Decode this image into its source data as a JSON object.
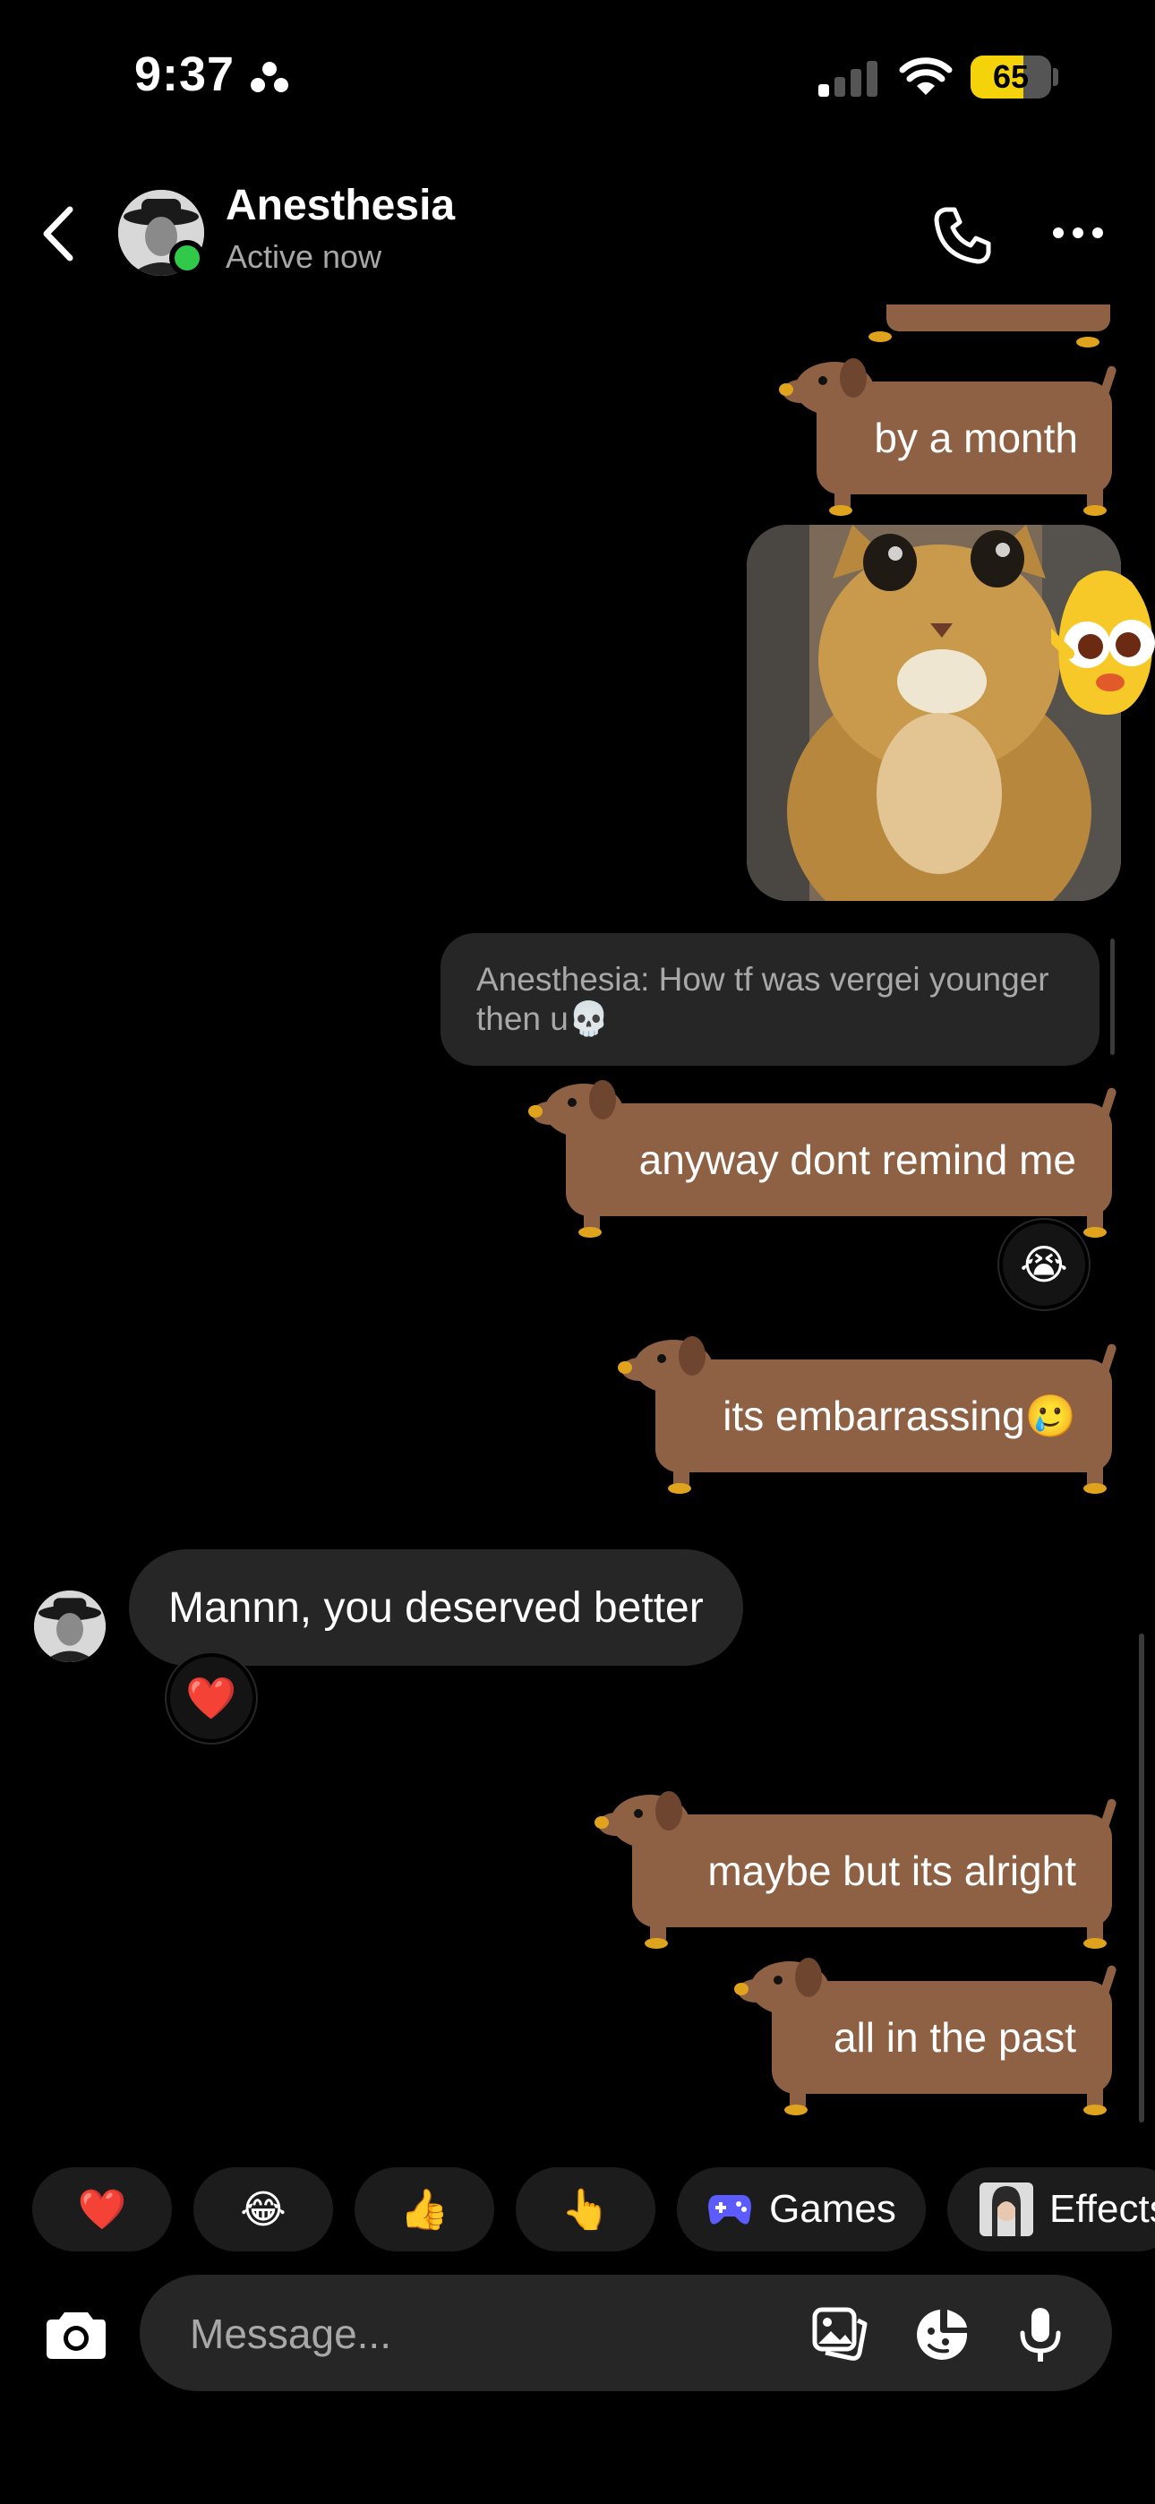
{
  "status_bar": {
    "time": "9:37",
    "battery": "65",
    "battery_level": 0.65
  },
  "header": {
    "name": "Anesthesia",
    "status": "Active now"
  },
  "messages": {
    "m1": "by a month",
    "reply_preview": "Anesthesia: How tf was vergei younger then u💀",
    "m2": "anyway dont remind me",
    "m2_reaction": "😭",
    "m3": "its embarrassing🥲",
    "incoming": "Mannn, you deserved better",
    "incoming_reaction": "❤️",
    "m4": "maybe but its alright",
    "m5": "all in the past"
  },
  "quick_replies": {
    "heart": "❤️",
    "laugh": "😂",
    "thumbs": "👍",
    "point": "👆",
    "games": "Games",
    "effects": "Effects"
  },
  "composer": {
    "placeholder": "Message..."
  },
  "colors": {
    "bubble_dog": "#8e6145",
    "online": "#31c94a",
    "battery": "#f5d30b"
  }
}
